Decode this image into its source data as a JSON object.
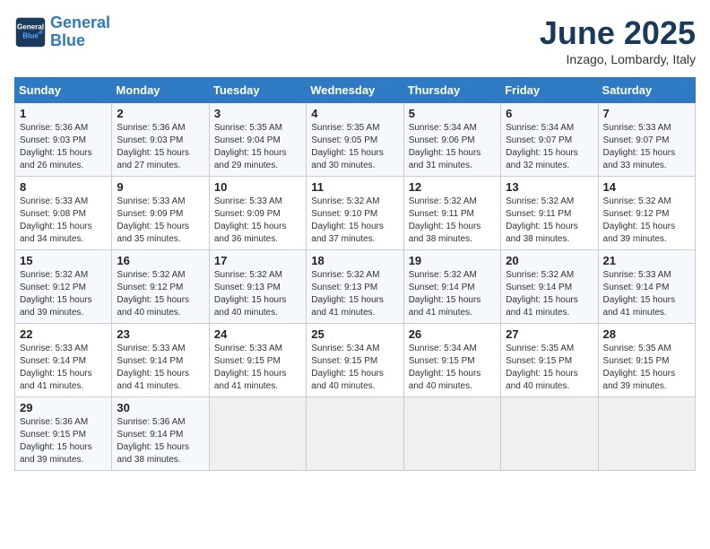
{
  "header": {
    "logo_line1": "General",
    "logo_line2": "Blue",
    "month_title": "June 2025",
    "location": "Inzago, Lombardy, Italy"
  },
  "weekdays": [
    "Sunday",
    "Monday",
    "Tuesday",
    "Wednesday",
    "Thursday",
    "Friday",
    "Saturday"
  ],
  "rows": [
    [
      {
        "day": "1",
        "sunrise": "5:36 AM",
        "sunset": "9:03 PM",
        "daylight": "15 hours and 26 minutes."
      },
      {
        "day": "2",
        "sunrise": "5:36 AM",
        "sunset": "9:03 PM",
        "daylight": "15 hours and 27 minutes."
      },
      {
        "day": "3",
        "sunrise": "5:35 AM",
        "sunset": "9:04 PM",
        "daylight": "15 hours and 29 minutes."
      },
      {
        "day": "4",
        "sunrise": "5:35 AM",
        "sunset": "9:05 PM",
        "daylight": "15 hours and 30 minutes."
      },
      {
        "day": "5",
        "sunrise": "5:34 AM",
        "sunset": "9:06 PM",
        "daylight": "15 hours and 31 minutes."
      },
      {
        "day": "6",
        "sunrise": "5:34 AM",
        "sunset": "9:07 PM",
        "daylight": "15 hours and 32 minutes."
      },
      {
        "day": "7",
        "sunrise": "5:33 AM",
        "sunset": "9:07 PM",
        "daylight": "15 hours and 33 minutes."
      }
    ],
    [
      {
        "day": "8",
        "sunrise": "5:33 AM",
        "sunset": "9:08 PM",
        "daylight": "15 hours and 34 minutes."
      },
      {
        "day": "9",
        "sunrise": "5:33 AM",
        "sunset": "9:09 PM",
        "daylight": "15 hours and 35 minutes."
      },
      {
        "day": "10",
        "sunrise": "5:33 AM",
        "sunset": "9:09 PM",
        "daylight": "15 hours and 36 minutes."
      },
      {
        "day": "11",
        "sunrise": "5:32 AM",
        "sunset": "9:10 PM",
        "daylight": "15 hours and 37 minutes."
      },
      {
        "day": "12",
        "sunrise": "5:32 AM",
        "sunset": "9:11 PM",
        "daylight": "15 hours and 38 minutes."
      },
      {
        "day": "13",
        "sunrise": "5:32 AM",
        "sunset": "9:11 PM",
        "daylight": "15 hours and 38 minutes."
      },
      {
        "day": "14",
        "sunrise": "5:32 AM",
        "sunset": "9:12 PM",
        "daylight": "15 hours and 39 minutes."
      }
    ],
    [
      {
        "day": "15",
        "sunrise": "5:32 AM",
        "sunset": "9:12 PM",
        "daylight": "15 hours and 39 minutes."
      },
      {
        "day": "16",
        "sunrise": "5:32 AM",
        "sunset": "9:12 PM",
        "daylight": "15 hours and 40 minutes."
      },
      {
        "day": "17",
        "sunrise": "5:32 AM",
        "sunset": "9:13 PM",
        "daylight": "15 hours and 40 minutes."
      },
      {
        "day": "18",
        "sunrise": "5:32 AM",
        "sunset": "9:13 PM",
        "daylight": "15 hours and 41 minutes."
      },
      {
        "day": "19",
        "sunrise": "5:32 AM",
        "sunset": "9:14 PM",
        "daylight": "15 hours and 41 minutes."
      },
      {
        "day": "20",
        "sunrise": "5:32 AM",
        "sunset": "9:14 PM",
        "daylight": "15 hours and 41 minutes."
      },
      {
        "day": "21",
        "sunrise": "5:33 AM",
        "sunset": "9:14 PM",
        "daylight": "15 hours and 41 minutes."
      }
    ],
    [
      {
        "day": "22",
        "sunrise": "5:33 AM",
        "sunset": "9:14 PM",
        "daylight": "15 hours and 41 minutes."
      },
      {
        "day": "23",
        "sunrise": "5:33 AM",
        "sunset": "9:14 PM",
        "daylight": "15 hours and 41 minutes."
      },
      {
        "day": "24",
        "sunrise": "5:33 AM",
        "sunset": "9:15 PM",
        "daylight": "15 hours and 41 minutes."
      },
      {
        "day": "25",
        "sunrise": "5:34 AM",
        "sunset": "9:15 PM",
        "daylight": "15 hours and 40 minutes."
      },
      {
        "day": "26",
        "sunrise": "5:34 AM",
        "sunset": "9:15 PM",
        "daylight": "15 hours and 40 minutes."
      },
      {
        "day": "27",
        "sunrise": "5:35 AM",
        "sunset": "9:15 PM",
        "daylight": "15 hours and 40 minutes."
      },
      {
        "day": "28",
        "sunrise": "5:35 AM",
        "sunset": "9:15 PM",
        "daylight": "15 hours and 39 minutes."
      }
    ],
    [
      {
        "day": "29",
        "sunrise": "5:36 AM",
        "sunset": "9:15 PM",
        "daylight": "15 hours and 39 minutes."
      },
      {
        "day": "30",
        "sunrise": "5:36 AM",
        "sunset": "9:14 PM",
        "daylight": "15 hours and 38 minutes."
      },
      null,
      null,
      null,
      null,
      null
    ]
  ]
}
